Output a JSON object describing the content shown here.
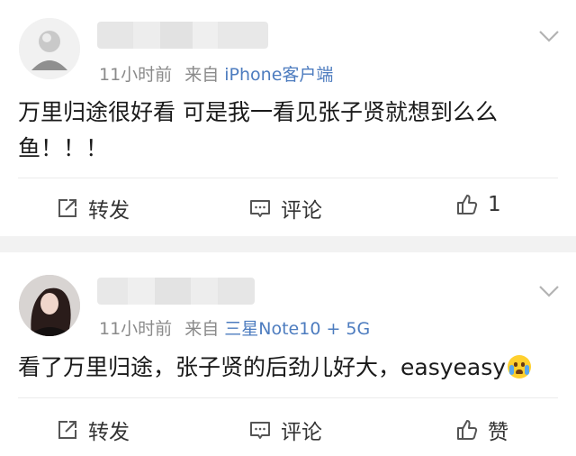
{
  "posts": [
    {
      "time": "11小时前",
      "source_prefix": "来自",
      "source": "iPhone客户端",
      "content": "万里归途很好看 可是我一看见张子贤就想到么么鱼！！！",
      "actions": {
        "repost": "转发",
        "comment": "评论",
        "like": "1"
      }
    },
    {
      "time": "11小时前",
      "source_prefix": "来自",
      "source": "三星Note10 + 5G",
      "content": "看了万里归途，张子贤的后劲儿好大，easyeasy",
      "actions": {
        "repost": "转发",
        "comment": "评论",
        "like": "赞"
      }
    }
  ],
  "icons": {
    "more": "chevron-down-icon",
    "repost": "share-square-icon",
    "comment": "comment-bubble-icon",
    "like": "thumbs-up-icon",
    "emoji": "crying-face-emoji"
  },
  "colors": {
    "source_link": "#4d7cbf",
    "meta": "#8a8a8a",
    "separator": "#f2f2f2"
  }
}
